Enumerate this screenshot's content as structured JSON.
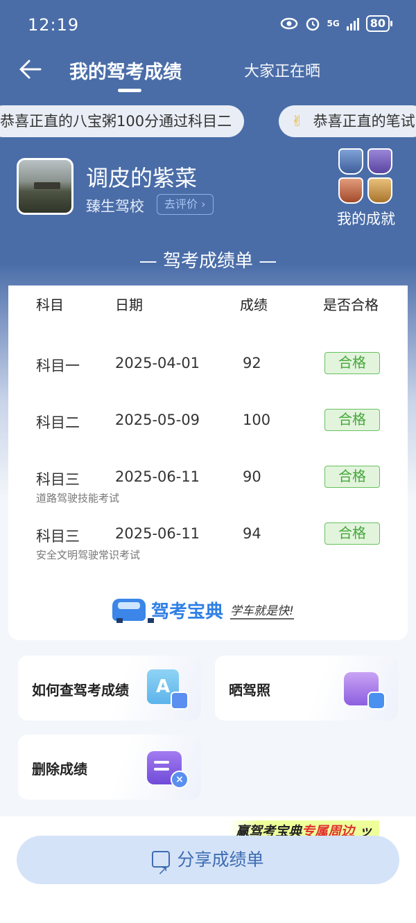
{
  "status_bar": {
    "time": "12:19",
    "signal": "5G",
    "battery": "80"
  },
  "nav": {
    "title": "我的驾考成绩",
    "tab2": "大家正在晒"
  },
  "marquee": {
    "item1": "恭喜正直的八宝粥100分通过科目二",
    "item2": "恭喜正直的笔试"
  },
  "profile": {
    "name": "调皮的紫菜",
    "school": "臻生驾校",
    "rate_button": "去评价 ›"
  },
  "achievements": {
    "label": "我的成就"
  },
  "sheet": {
    "title": "— 驾考成绩单 —",
    "headers": {
      "subject": "科目",
      "date": "日期",
      "score": "成绩",
      "pass": "是否合格"
    },
    "rows": [
      {
        "subject": "科目一",
        "date": "2025-04-01",
        "score": "92",
        "pass": "合格",
        "note": ""
      },
      {
        "subject": "科目二",
        "date": "2025-05-09",
        "score": "100",
        "pass": "合格",
        "note": ""
      },
      {
        "subject": "科目三",
        "date": "2025-06-11",
        "score": "90",
        "pass": "合格",
        "note": "道路驾驶技能考试"
      },
      {
        "subject": "科目三",
        "date": "2025-06-11",
        "score": "94",
        "pass": "合格",
        "note": "安全文明驾驶常识考试"
      }
    ],
    "brand_name": "驾考宝典",
    "brand_slogan": "学车就是快!"
  },
  "tiles": {
    "how_to_check": "如何查驾考成绩",
    "show_license": "晒驾照",
    "delete_scores": "删除成绩"
  },
  "bottom": {
    "promo_prefix": "赢驾考宝典",
    "promo_highlight": "专属周边",
    "share_button": "分享成绩单"
  },
  "colors": {
    "header_blue": "#4a6da8",
    "pass_green": "#45a63b",
    "brand_blue": "#2f7fe6"
  }
}
